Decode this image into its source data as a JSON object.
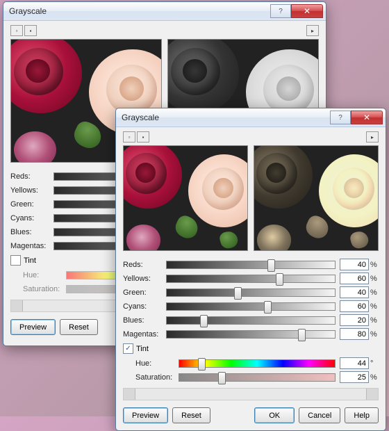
{
  "back": {
    "title": "Grayscale",
    "sliders": [
      {
        "label": "Reds:"
      },
      {
        "label": "Yellows:"
      },
      {
        "label": "Green:"
      },
      {
        "label": "Cyans:"
      },
      {
        "label": "Blues:"
      },
      {
        "label": "Magentas:"
      }
    ],
    "tint": {
      "label": "Tint",
      "checked": false,
      "hue_label": "Hue:",
      "sat_label": "Saturation:"
    },
    "buttons": {
      "preview": "Preview",
      "reset": "Reset"
    }
  },
  "front": {
    "title": "Grayscale",
    "sliders": [
      {
        "label": "Reds:",
        "value": 40,
        "unit": "%"
      },
      {
        "label": "Yellows:",
        "value": 60,
        "unit": "%"
      },
      {
        "label": "Green:",
        "value": 40,
        "unit": "%"
      },
      {
        "label": "Cyans:",
        "value": 60,
        "unit": "%"
      },
      {
        "label": "Blues:",
        "value": 20,
        "unit": "%"
      },
      {
        "label": "Magentas:",
        "value": 80,
        "unit": "%"
      }
    ],
    "tint": {
      "label": "Tint",
      "checked": true,
      "hue": {
        "label": "Hue:",
        "value": 44,
        "unit": "°"
      },
      "saturation": {
        "label": "Saturation:",
        "value": 25,
        "unit": "%"
      }
    },
    "buttons": {
      "preview": "Preview",
      "reset": "Reset",
      "ok": "OK",
      "cancel": "Cancel",
      "help": "Help"
    }
  }
}
